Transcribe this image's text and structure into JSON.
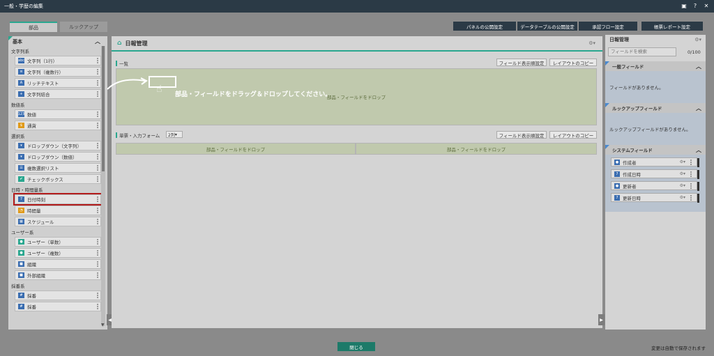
{
  "window": {
    "title": "一般・学歴の編集"
  },
  "titlebar_icons": [
    "restore-icon",
    "help-icon",
    "close-icon"
  ],
  "titlebar_glyphs": [
    "▣",
    "?",
    "✕"
  ],
  "left": {
    "tabs": [
      "部品",
      "ルックアップ"
    ],
    "section": "基本",
    "chevron": "︿",
    "groups": [
      {
        "label": "文字列系",
        "items": [
          {
            "label": "文字列（1行）",
            "icon": "abc",
            "color": "#3a6db0"
          },
          {
            "label": "文字列（複数行）",
            "icon": "≡",
            "color": "#3a6db0"
          },
          {
            "label": "リッチテキスト",
            "icon": "A",
            "color": "#3a6db0"
          },
          {
            "label": "文字列結合",
            "icon": "+",
            "color": "#3a6db0"
          }
        ]
      },
      {
        "label": "数値系",
        "items": [
          {
            "label": "数値",
            "icon": "123",
            "color": "#3a6db0"
          },
          {
            "label": "通貨",
            "icon": "$",
            "color": "#e09a1a"
          }
        ]
      },
      {
        "label": "選択系",
        "items": [
          {
            "label": "ドロップダウン（文字列）",
            "icon": "▾",
            "color": "#3a6db0"
          },
          {
            "label": "ドロップダウン（数値）",
            "icon": "▾",
            "color": "#3a6db0"
          },
          {
            "label": "複数選択リスト",
            "icon": "☰",
            "color": "#3a6db0"
          },
          {
            "label": "チェックボックス",
            "icon": "✔",
            "color": "#2aa78f"
          }
        ]
      },
      {
        "label": "日時・時間量系",
        "items": [
          {
            "label": "日付時刻",
            "icon": "7",
            "color": "#3a6db0",
            "highlight": true
          },
          {
            "label": "時間量",
            "icon": "◔",
            "color": "#e09a1a"
          },
          {
            "label": "スケジュール",
            "icon": "▦",
            "color": "#3a6db0"
          }
        ]
      },
      {
        "label": "ユーザー系",
        "items": [
          {
            "label": "ユーザー（単数）",
            "icon": "●",
            "color": "#2aa78f"
          },
          {
            "label": "ユーザー（複数）",
            "icon": "●",
            "color": "#2aa78f"
          },
          {
            "label": "組織",
            "icon": "■",
            "color": "#3a6db0"
          },
          {
            "label": "外部組織",
            "icon": "■",
            "color": "#3a6db0"
          }
        ]
      },
      {
        "label": "採番系",
        "items": [
          {
            "label": "採番",
            "icon": "#",
            "color": "#3a6db0"
          },
          {
            "label": "採番",
            "icon": "#",
            "color": "#3a6db0"
          }
        ]
      }
    ]
  },
  "top_buttons": [
    "パネルの公開設定",
    "データテーブルの公開設定",
    "承認フロー設定",
    "帳票レポート設定"
  ],
  "center": {
    "title": "日報管理",
    "list_label": "一覧",
    "field_display_btn": "フィールド表示順設定",
    "layout_copy_btn": "レイアウトのコピー",
    "drag_hint": "部品・フィールドをドラッグ＆ドロップしてください。",
    "drop_label": "部品・フィールドをドロップ",
    "form_label": "単票・入力フォーム",
    "column_select": "2列",
    "field_display_btn2": "フィールド表示順設定",
    "layout_copy_btn2": "レイアウトのコピー",
    "drop_label_left": "部品・フィールドをドロップ",
    "drop_label_right": "部品・フィールドをドロップ"
  },
  "right": {
    "title": "日報管理",
    "search_placeholder": "フィールドを検索",
    "count": "0/100",
    "general_section": "一般フィールド",
    "general_empty": "フィールドがありません。",
    "lookup_section": "ルックアップフィールド",
    "lookup_empty": "ルックアップフィールドがありません。",
    "system_section": "システムフィールド",
    "system_items": [
      {
        "label": "作成者",
        "icon": "●",
        "color": "#3a6db0"
      },
      {
        "label": "作成日時",
        "icon": "7",
        "color": "#3a6db0"
      },
      {
        "label": "更新者",
        "icon": "●",
        "color": "#3a6db0"
      },
      {
        "label": "更新日時",
        "icon": "7",
        "color": "#3a6db0"
      }
    ]
  },
  "footer": {
    "close": "閉じる",
    "status": "変更は自動で保存されます"
  }
}
